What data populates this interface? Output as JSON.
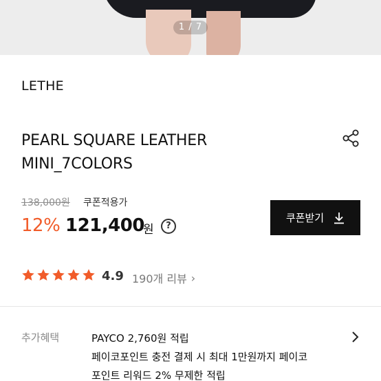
{
  "gallery": {
    "pager": "1 / 7"
  },
  "product": {
    "brand": "LETHE",
    "title": "PEARL SQUARE LEATHER MINI_7COLORS",
    "share_icon": "share-icon"
  },
  "pricing": {
    "original_price": "138,000원",
    "coupon_note": "쿠폰적용가",
    "discount": "12%",
    "price": "121,400",
    "currency": "원",
    "help_icon_text": "?",
    "coupon_button_label": "쿠폰받기",
    "coupon_button_icon": "download-icon",
    "accent_color": "#f15c2a"
  },
  "rating": {
    "stars": 5,
    "score": "4.9",
    "reviews_label": "190개 리뷰",
    "reviews_chevron": "›",
    "star_color": "#f15c2a"
  },
  "benefits": {
    "label": "추가혜택",
    "lines": [
      "PAYCO 2,760원 적립",
      "페이코포인트 충전 결제 시 최대 1만원까지 페이코",
      "포인트 리워드 2% 무제한 적립"
    ],
    "arrow_icon": "chevron-right-icon"
  }
}
